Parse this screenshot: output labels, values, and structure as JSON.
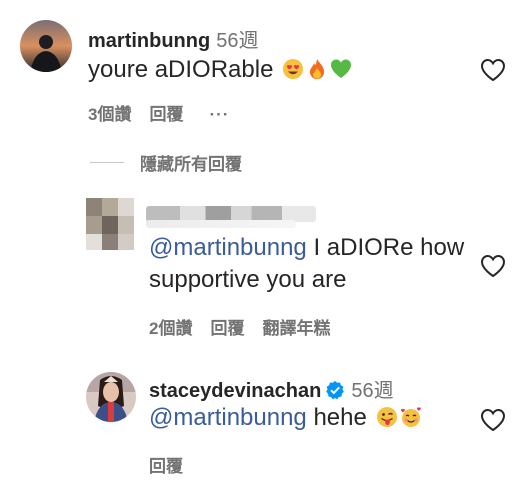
{
  "comments": [
    {
      "username": "martinbunng",
      "timestamp": "56週",
      "text": "youre aDIORable",
      "emojis": [
        "heart-eyes-emoji",
        "fire-emoji",
        "green-heart-emoji"
      ],
      "actions": {
        "replies": "3個讚",
        "reply": "回覆",
        "more": "···"
      }
    },
    {
      "mention": "@martinbunng",
      "text": " I aDIORe how supportive you are",
      "actions": {
        "likes": "2個讚",
        "reply": "回覆",
        "translate": "翻譯年糕"
      }
    },
    {
      "username": "staceydevinachan",
      "timestamp": "56週",
      "mention": "@martinbunng",
      "text": " hehe",
      "emojis": [
        "tongue-out-emoji",
        "smiling-hearts-emoji"
      ],
      "actions": {
        "reply": "回覆"
      }
    }
  ],
  "hide_replies": {
    "label": "隱藏所有回覆"
  },
  "colors": {
    "mention": "#3b5c9b",
    "muted": "#737373",
    "text": "#262626",
    "verified": "#0095f6"
  }
}
